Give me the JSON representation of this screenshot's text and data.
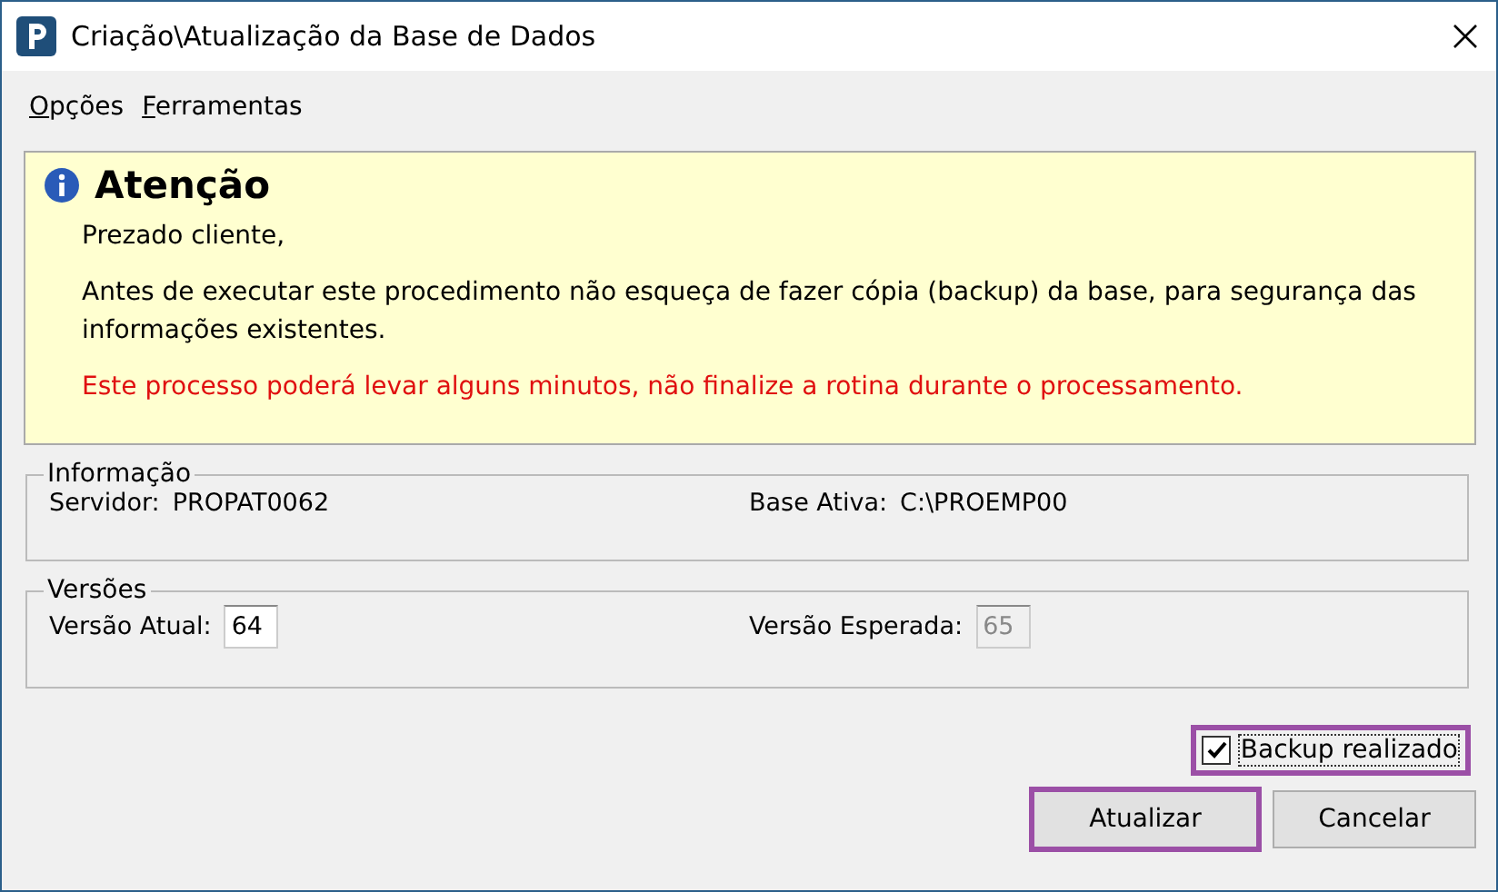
{
  "window": {
    "title": "Criação\\Atualização da Base de Dados"
  },
  "menu": [
    {
      "label": "Opções"
    },
    {
      "label": "Ferramentas"
    }
  ],
  "notice": {
    "title": "Atenção",
    "greeting": "Prezado cliente,",
    "message": "Antes de executar este procedimento não esqueça de fazer cópia (backup) da base, para segurança das informações existentes.",
    "warning": "Este processo poderá levar alguns minutos, não finalize a rotina durante o processamento."
  },
  "info": {
    "legend": "Informação",
    "server_label": "Servidor:",
    "server": "PROPAT0062",
    "base_label": "Base Ativa:",
    "base": "C:\\PROEMP00"
  },
  "versions": {
    "legend": "Versões",
    "current_label": "Versão Atual:",
    "current": "64",
    "expected_label": "Versão Esperada:",
    "expected": "65",
    "expected_disabled": true
  },
  "backup": {
    "label": "Backup realizado",
    "checked": true,
    "highlighted": true
  },
  "buttons": [
    {
      "label": "Atualizar",
      "highlighted": true
    },
    {
      "label": "Cancelar",
      "highlighted": false
    }
  ]
}
